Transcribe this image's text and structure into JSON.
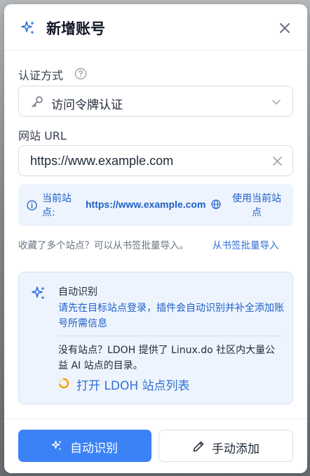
{
  "dialog": {
    "title": "新增账号",
    "close_icon": "close-icon"
  },
  "auth": {
    "label": "认证方式",
    "help_icon": "help-circle-icon",
    "selected": "访问令牌认证",
    "icon": "key-icon"
  },
  "site": {
    "label": "网站 URL",
    "value": "https://www.example.com",
    "current_label": "当前站点:",
    "current_url": "https://www.example.com",
    "use_current": "使用当前站点"
  },
  "bookmark": {
    "hint": "收藏了多个站点？可以从书签批量导入。",
    "link": "从书签批量导入"
  },
  "auto_detect": {
    "heading": "自动识别",
    "description": "请先在目标站点登录，插件会自动识别并补全添加账号所需信息",
    "no_site": "没有站点？LDOH 提供了 Linux.do 社区内大量公益 AI 站点的目录。",
    "ldoh_link": "打开 LDOH 站点列表"
  },
  "footer": {
    "auto_button": "自动识别",
    "manual_button": "手动添加"
  },
  "colors": {
    "accent": "#3b82f6",
    "link": "#2f6fd6",
    "info_bg": "#eef4fd"
  }
}
